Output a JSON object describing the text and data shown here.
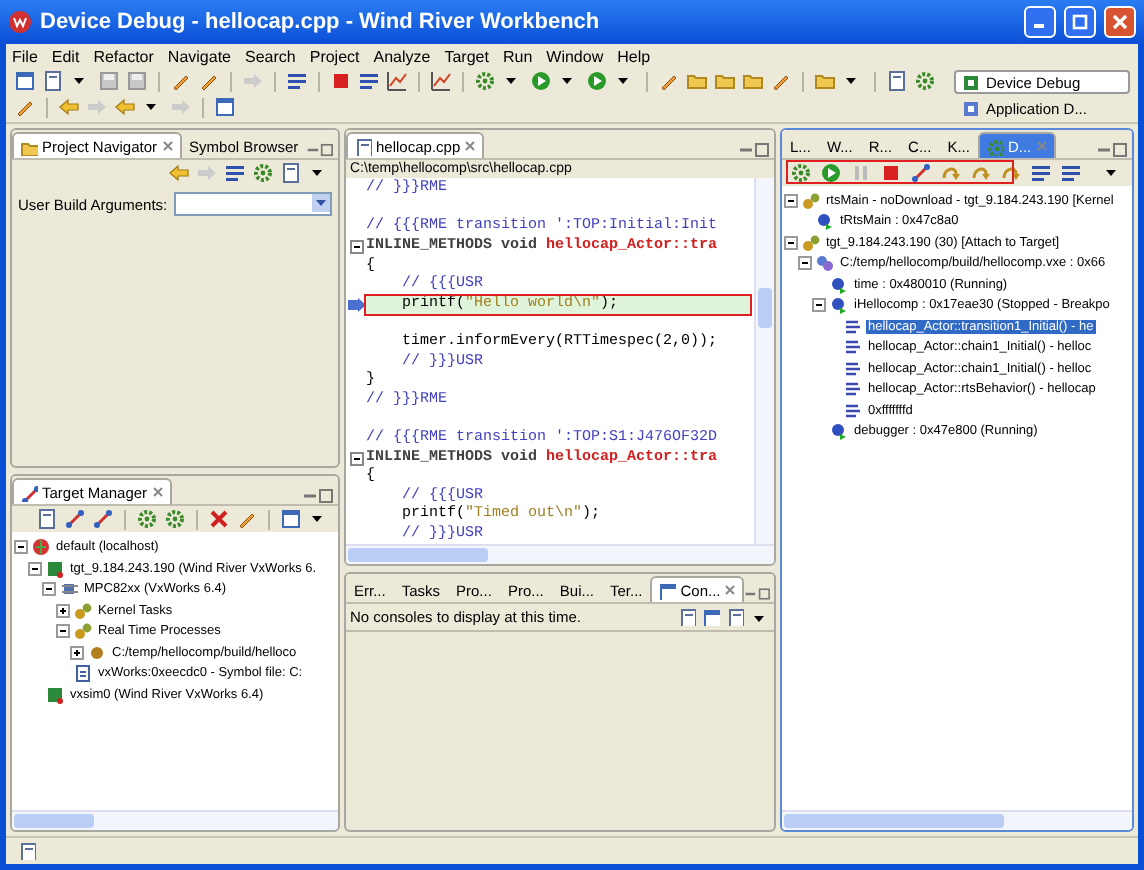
{
  "window": {
    "title": "Device Debug - hellocap.cpp - Wind River Workbench"
  },
  "menu": [
    "File",
    "Edit",
    "Refactor",
    "Navigate",
    "Search",
    "Project",
    "Analyze",
    "Target",
    "Run",
    "Window",
    "Help"
  ],
  "perspectives": [
    {
      "label": "Device Debug",
      "selected": true
    },
    {
      "label": "Application D...",
      "selected": false
    }
  ],
  "project_panel": {
    "active": false,
    "tabs": [
      {
        "label": "Project Navigator",
        "selected": true
      },
      {
        "label": "Symbol Browser",
        "selected": false
      }
    ],
    "field_label": "User Build Arguments:"
  },
  "target_manager": {
    "active": false,
    "tabs": [
      {
        "label": "Target Manager",
        "selected": true
      }
    ],
    "tree": [
      {
        "label": "default (localhost)",
        "kind": "host",
        "expanded": true,
        "children": [
          {
            "label": "tgt_9.184.243.190 (Wind River VxWorks 6.",
            "kind": "target",
            "expanded": true,
            "children": [
              {
                "label": "MPC82xx (VxWorks 6.4)",
                "kind": "chip",
                "expanded": true,
                "children": [
                  {
                    "label": "Kernel Tasks",
                    "kind": "gears",
                    "expanded": false
                  },
                  {
                    "label": "Real Time Processes",
                    "kind": "gears",
                    "expanded": true,
                    "children": [
                      {
                        "label": "C:/temp/hellocomp/build/helloco",
                        "kind": "gear",
                        "expanded": false
                      }
                    ]
                  },
                  {
                    "label": "vxWorks:0xeecdc0 - Symbol file: C:",
                    "kind": "file"
                  }
                ]
              }
            ]
          },
          {
            "label": "vxsim0 (Wind River VxWorks 6.4)",
            "kind": "target"
          }
        ]
      }
    ]
  },
  "editor": {
    "active": false,
    "tabs": [
      {
        "label": "hellocap.cpp",
        "selected": true
      }
    ],
    "path": "C:\\temp\\hellocomp\\src\\hellocap.cpp",
    "blocks": [
      {
        "lines": [
          {
            "fold": false,
            "current": false,
            "tokens": [
              {
                "kind": "comment",
                "t": "// }}}RME"
              }
            ]
          }
        ]
      },
      {
        "lines": [
          {
            "fold": false,
            "current": false,
            "tokens": [
              {
                "kind": "comment",
                "t": "// {{{RME transition ':TOP:Initial:Init"
              }
            ]
          },
          {
            "fold": true,
            "current": false,
            "tokens": [
              {
                "kind": "keyword",
                "t": "INLINE_METHODS void "
              },
              {
                "kind": "name",
                "t": "hellocap_Actor::tra"
              }
            ]
          },
          {
            "fold": false,
            "current": false,
            "tokens": [
              {
                "kind": "plain",
                "t": "{"
              }
            ]
          },
          {
            "fold": false,
            "current": false,
            "tokens": [
              {
                "kind": "comment",
                "t": "    // {{{USR"
              }
            ]
          },
          {
            "fold": false,
            "current": true,
            "tokens": [
              {
                "kind": "plain",
                "t": "    printf("
              },
              {
                "kind": "string",
                "t": "\"Hello world\\n\""
              },
              {
                "kind": "plain",
                "t": ");"
              }
            ]
          }
        ]
      },
      {
        "lines": [
          {
            "fold": false,
            "current": false,
            "tokens": [
              {
                "kind": "plain",
                "t": "    timer.informEvery(RTTimespec(2,0));"
              }
            ]
          },
          {
            "fold": false,
            "current": false,
            "tokens": [
              {
                "kind": "comment",
                "t": "    // }}}USR"
              }
            ]
          },
          {
            "fold": false,
            "current": false,
            "tokens": [
              {
                "kind": "plain",
                "t": "}"
              }
            ]
          },
          {
            "fold": false,
            "current": false,
            "tokens": [
              {
                "kind": "comment",
                "t": "// }}}RME"
              }
            ]
          }
        ]
      },
      {
        "lines": [
          {
            "fold": false,
            "current": false,
            "tokens": [
              {
                "kind": "comment",
                "t": "// {{{RME transition ':TOP:S1:J476OF32D"
              }
            ]
          },
          {
            "fold": true,
            "current": false,
            "tokens": [
              {
                "kind": "keyword",
                "t": "INLINE_METHODS void "
              },
              {
                "kind": "name",
                "t": "hellocap_Actor::tra"
              }
            ]
          },
          {
            "fold": false,
            "current": false,
            "tokens": [
              {
                "kind": "plain",
                "t": "{"
              }
            ]
          },
          {
            "fold": false,
            "current": false,
            "tokens": [
              {
                "kind": "comment",
                "t": "    // {{{USR"
              }
            ]
          },
          {
            "fold": false,
            "current": false,
            "tokens": [
              {
                "kind": "plain",
                "t": "    printf("
              },
              {
                "kind": "string",
                "t": "\"Timed out\\n\""
              },
              {
                "kind": "plain",
                "t": ");"
              }
            ]
          },
          {
            "fold": false,
            "current": false,
            "tokens": [
              {
                "kind": "comment",
                "t": "    // }}}USR"
              }
            ]
          }
        ]
      }
    ]
  },
  "console": {
    "active": false,
    "tabs": [
      {
        "label": "Err...",
        "selected": false
      },
      {
        "label": "Tasks",
        "selected": false
      },
      {
        "label": "Pro...",
        "selected": false
      },
      {
        "label": "Pro...",
        "selected": false
      },
      {
        "label": "Bui...",
        "selected": false
      },
      {
        "label": "Ter...",
        "selected": false
      },
      {
        "label": "Con...",
        "selected": true
      }
    ],
    "message": "No consoles to display at this time."
  },
  "debug": {
    "active": true,
    "tabs": [
      {
        "label": "L...",
        "selected": false
      },
      {
        "label": "W...",
        "selected": false
      },
      {
        "label": "R...",
        "selected": false
      },
      {
        "label": "C...",
        "selected": false
      },
      {
        "label": "K...",
        "selected": false
      },
      {
        "label": "D...",
        "selected": true
      }
    ],
    "tree": [
      {
        "label": "rtsMain - noDownload - tgt_9.184.243.190 [Kernel",
        "kind": "gears",
        "expanded": true,
        "selected": false,
        "children": [
          {
            "label": "tRtsMain : 0x47c8a0",
            "kind": "task",
            "selected": false
          }
        ]
      },
      {
        "label": "tgt_9.184.243.190 (30) [Attach to Target]",
        "kind": "gears",
        "expanded": true,
        "selected": false,
        "children": [
          {
            "label": "C:/temp/hellocomp/build/hellocomp.vxe : 0x66",
            "kind": "process",
            "expanded": true,
            "selected": false,
            "children": [
              {
                "label": "time : 0x480010 (Running)",
                "kind": "task",
                "selected": false
              },
              {
                "label": "iHellocomp : 0x17eae30 (Stopped - Breakpo",
                "kind": "task",
                "expanded": true,
                "selected": false,
                "children": [
                  {
                    "label": "hellocap_Actor::transition1_Initial() - he",
                    "kind": "frame",
                    "selected": true
                  },
                  {
                    "label": "hellocap_Actor::chain1_Initial() - helloc",
                    "kind": "frame",
                    "selected": false
                  },
                  {
                    "label": "hellocap_Actor::chain1_Initial() - helloc",
                    "kind": "frame",
                    "selected": false
                  },
                  {
                    "label": "hellocap_Actor::rtsBehavior() - hellocap",
                    "kind": "frame",
                    "selected": false
                  },
                  {
                    "label": "0xfffffffd",
                    "kind": "frame",
                    "selected": false
                  }
                ]
              },
              {
                "label": "debugger : 0x47e800 (Running)",
                "kind": "task",
                "selected": false
              }
            ]
          }
        ]
      }
    ]
  }
}
